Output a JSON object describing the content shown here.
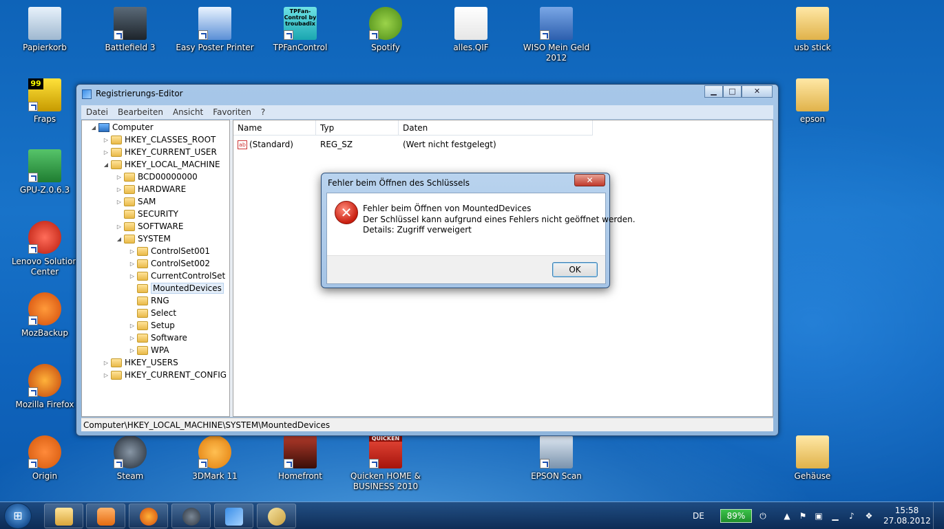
{
  "desktop": {
    "icons": [
      {
        "label": "Papierkorb",
        "icon": "recycle-bin-icon"
      },
      {
        "label": "Battlefield 3",
        "icon": "battlefield-icon"
      },
      {
        "label": "Easy Poster Printer",
        "icon": "poster-printer-icon"
      },
      {
        "label": "TPFanControl",
        "icon": "fan-control-icon",
        "badge": "TPFan-Control by troubadix"
      },
      {
        "label": "Spotify",
        "icon": "spotify-icon"
      },
      {
        "label": "alles.QIF",
        "icon": "file-icon"
      },
      {
        "label": "WISO Mein Geld 2012",
        "icon": "wiso-icon"
      },
      {
        "label": "usb stick",
        "icon": "folder-icon"
      },
      {
        "label": "Fraps",
        "icon": "fraps-icon",
        "badge": "99"
      },
      {
        "label": "epson",
        "icon": "folder-icon"
      },
      {
        "label": "GPU-Z.0.6.3",
        "icon": "gpuz-icon"
      },
      {
        "label": "Lenovo Solution Center",
        "icon": "lenovo-icon"
      },
      {
        "label": "MozBackup",
        "icon": "mozbackup-icon"
      },
      {
        "label": "Mozilla Firefox",
        "icon": "firefox-icon"
      },
      {
        "label": "Origin",
        "icon": "origin-icon"
      },
      {
        "label": "Steam",
        "icon": "steam-icon"
      },
      {
        "label": "3DMark 11",
        "icon": "3dmark-icon"
      },
      {
        "label": "Homefront",
        "icon": "homefront-icon"
      },
      {
        "label": "Quicken HOME & BUSINESS 2010",
        "icon": "quicken-icon",
        "badge": "QUICKEN"
      },
      {
        "label": "EPSON Scan",
        "icon": "epson-scan-icon"
      },
      {
        "label": "Gehäuse",
        "icon": "folder-icon"
      }
    ]
  },
  "regedit": {
    "title": "Registrierungs-Editor",
    "window_buttons": [
      "▁",
      "□",
      "✕"
    ],
    "menu": [
      "Datei",
      "Bearbeiten",
      "Ansicht",
      "Favoriten",
      "?"
    ],
    "tree": [
      {
        "label": "Computer",
        "level": 0,
        "expander": "◢"
      },
      {
        "label": "HKEY_CLASSES_ROOT",
        "level": 1,
        "expander": "▷"
      },
      {
        "label": "HKEY_CURRENT_USER",
        "level": 1,
        "expander": "▷"
      },
      {
        "label": "HKEY_LOCAL_MACHINE",
        "level": 1,
        "expander": "◢"
      },
      {
        "label": "BCD00000000",
        "level": 2,
        "expander": "▷"
      },
      {
        "label": "HARDWARE",
        "level": 2,
        "expander": "▷"
      },
      {
        "label": "SAM",
        "level": 2,
        "expander": "▷"
      },
      {
        "label": "SECURITY",
        "level": 2,
        "expander": ""
      },
      {
        "label": "SOFTWARE",
        "level": 2,
        "expander": "▷"
      },
      {
        "label": "SYSTEM",
        "level": 2,
        "expander": "◢"
      },
      {
        "label": "ControlSet001",
        "level": 3,
        "expander": "▷"
      },
      {
        "label": "ControlSet002",
        "level": 3,
        "expander": "▷"
      },
      {
        "label": "CurrentControlSet",
        "level": 3,
        "expander": "▷"
      },
      {
        "label": "MountedDevices",
        "level": 3,
        "expander": "",
        "selected": true
      },
      {
        "label": "RNG",
        "level": 3,
        "expander": ""
      },
      {
        "label": "Select",
        "level": 3,
        "expander": ""
      },
      {
        "label": "Setup",
        "level": 3,
        "expander": "▷"
      },
      {
        "label": "Software",
        "level": 3,
        "expander": "▷"
      },
      {
        "label": "WPA",
        "level": 3,
        "expander": "▷"
      },
      {
        "label": "HKEY_USERS",
        "level": 1,
        "expander": "▷"
      },
      {
        "label": "HKEY_CURRENT_CONFIG",
        "level": 1,
        "expander": "▷"
      }
    ],
    "columns": [
      "Name",
      "Typ",
      "Daten"
    ],
    "rows": [
      {
        "name": "(Standard)",
        "type": "REG_SZ",
        "data": "(Wert nicht festgelegt)",
        "icon_text": "ab"
      }
    ],
    "status_path": "Computer\\HKEY_LOCAL_MACHINE\\SYSTEM\\MountedDevices"
  },
  "dialog": {
    "title": "Fehler beim Öffnen des Schlüssels",
    "close_label": "✕",
    "error_glyph": "✕",
    "line1": "Fehler beim Öffnen von MountedDevices",
    "line2": "Der Schlüssel kann aufgrund eines Fehlers nicht geöffnet werden.",
    "line3": "Details: Zugriff verweigert",
    "ok_label": "OK"
  },
  "taskbar": {
    "start_glyph": "⊞",
    "apps": [
      "explorer-icon",
      "media-player-icon",
      "firefox-icon",
      "steam-icon",
      "regedit-icon",
      "paint-icon"
    ],
    "language": "DE",
    "battery": "89%",
    "time": "15:58",
    "date": "27.08.2012",
    "colors": {
      "accent": "#1873c9",
      "battery": "#2aa83a",
      "error": "#c81e0f"
    }
  }
}
